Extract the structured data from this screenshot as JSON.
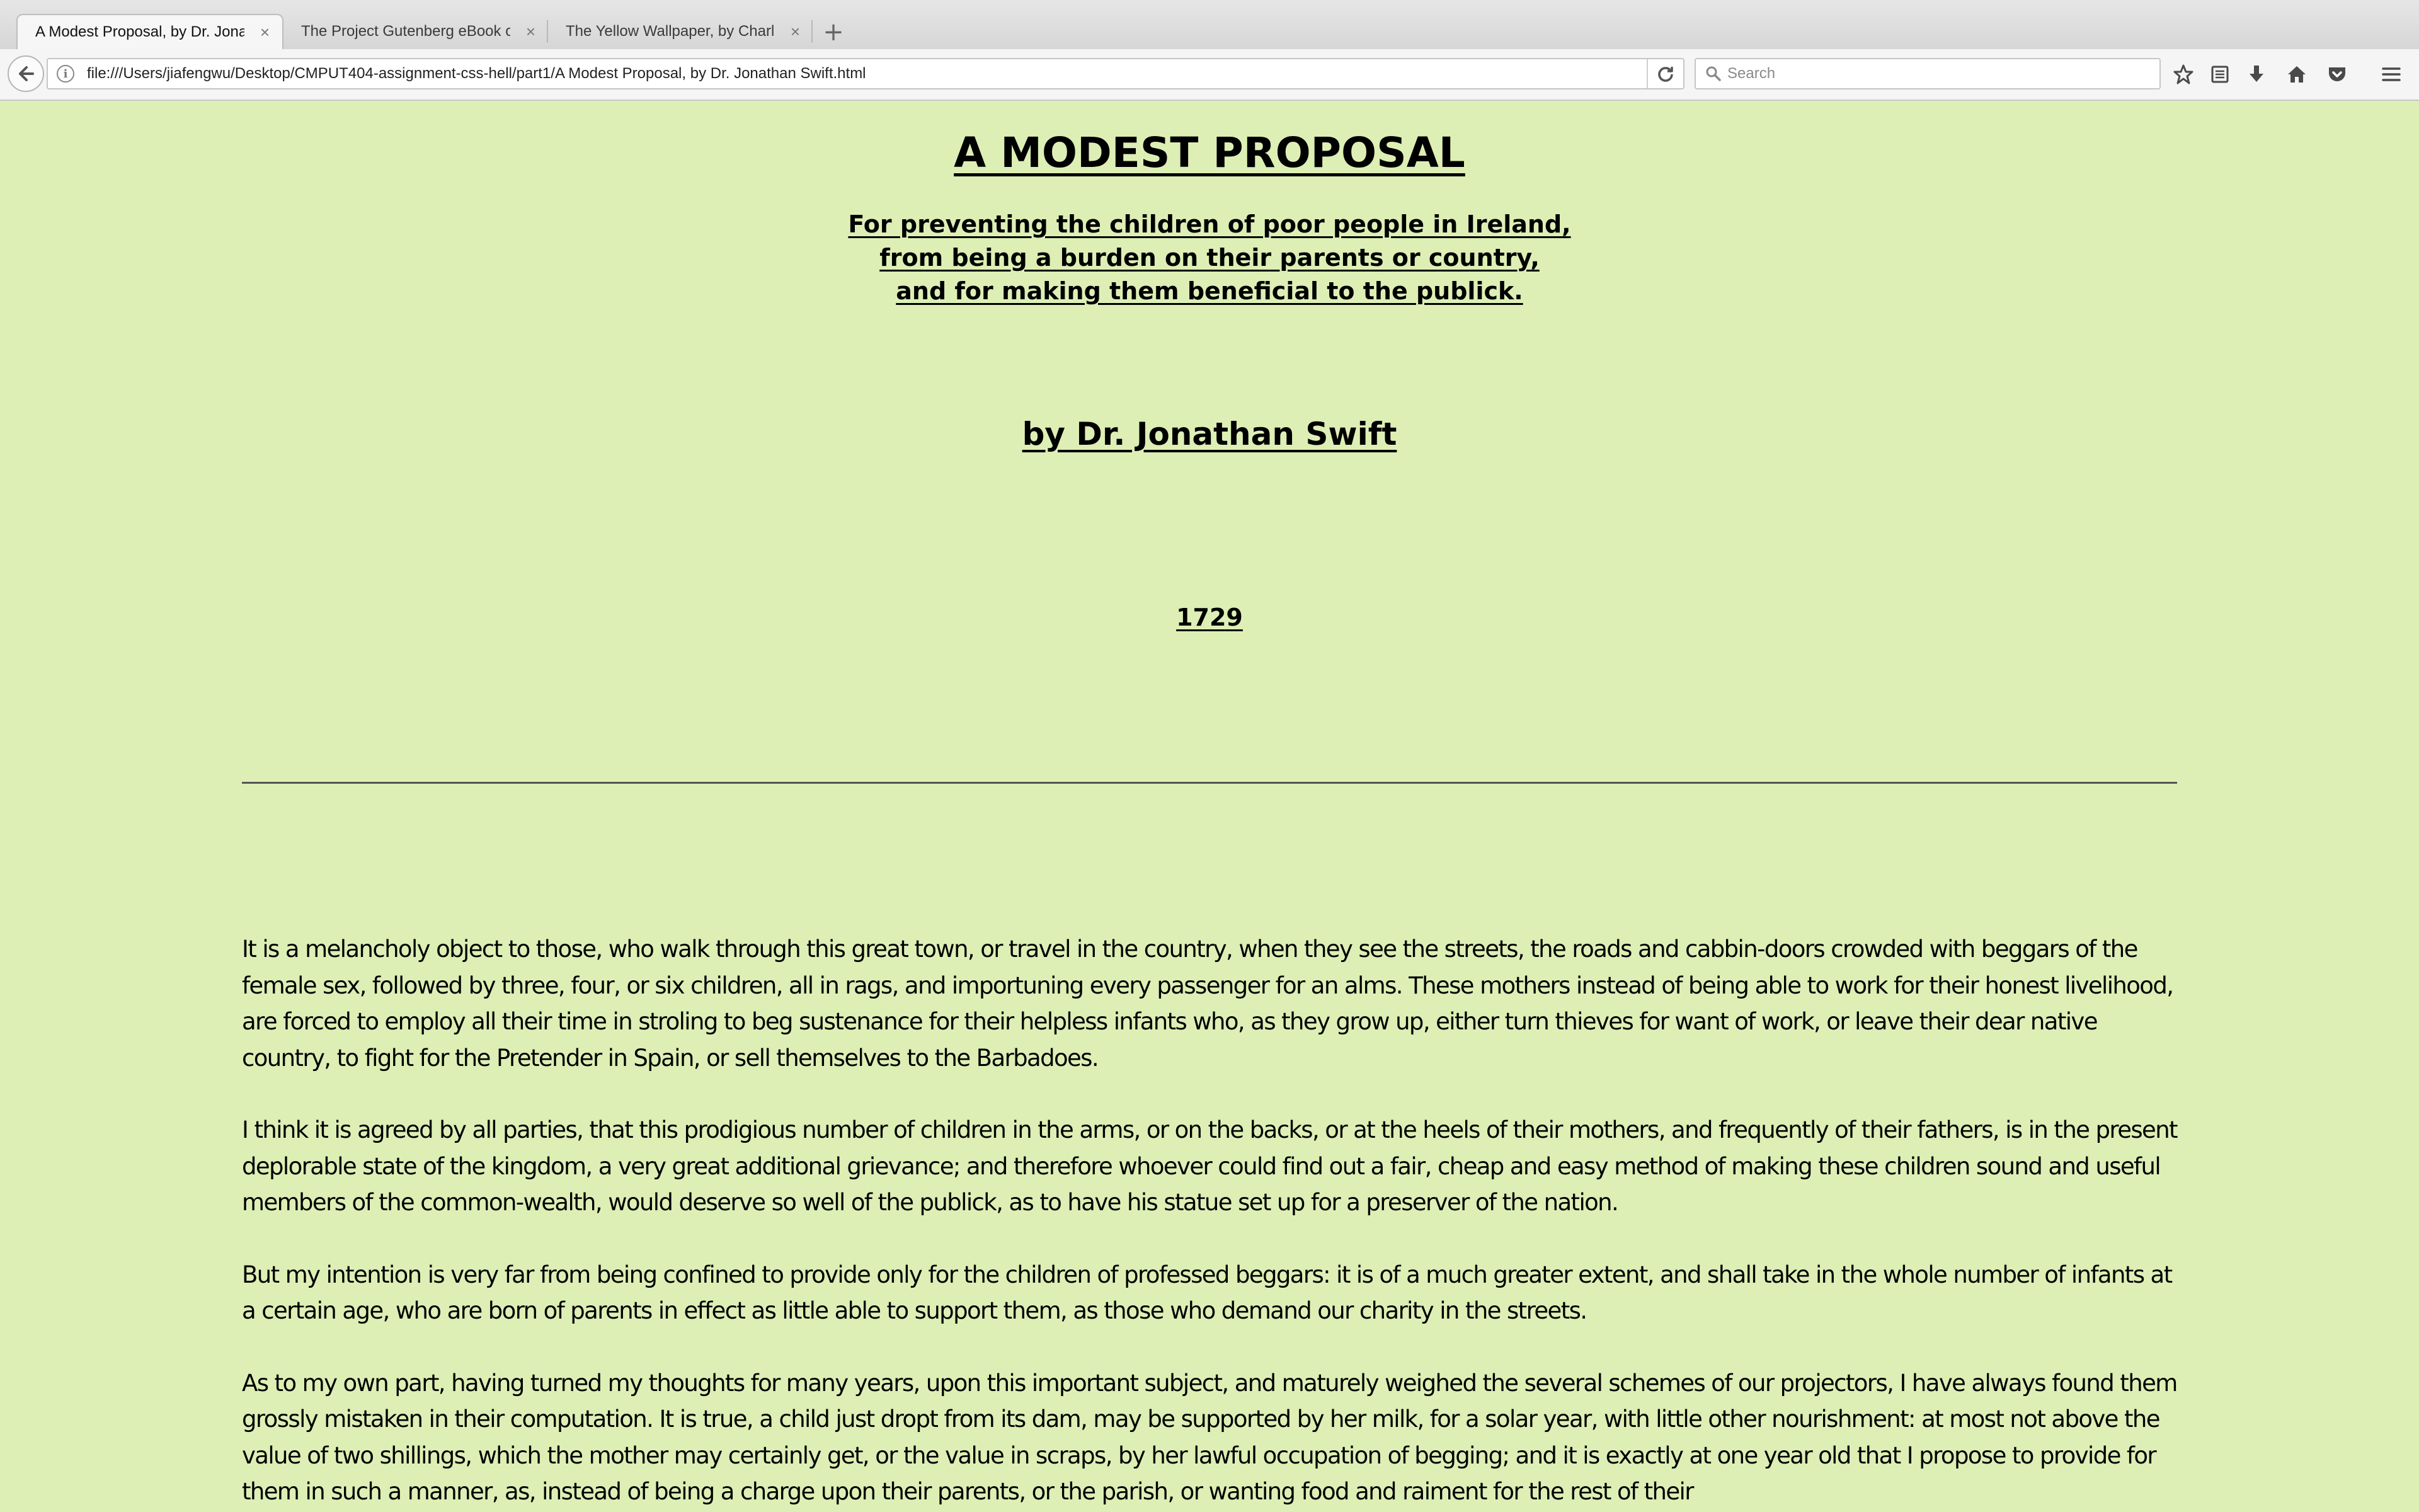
{
  "browser": {
    "tabs": [
      {
        "title": "A Modest Proposal, by Dr. Jona...",
        "active": true
      },
      {
        "title": "The Project Gutenberg eBook o...",
        "active": false
      },
      {
        "title": "The Yellow Wallpaper, by Charl...",
        "active": false
      }
    ],
    "tab_close_glyph": "×",
    "new_tab_glyph": "+",
    "url": "file:///Users/jiafengwu/Desktop/CMPUT404-assignment-css-hell/part1/A Modest Proposal, by Dr. Jonathan Swift.html",
    "search_placeholder": "Search",
    "toolbar_icons": [
      "bookmark-star-icon",
      "reading-list-icon",
      "downloads-icon",
      "home-icon",
      "pocket-icon",
      "menu-icon"
    ]
  },
  "page": {
    "title": "A MODEST PROPOSAL",
    "subtitle_lines": [
      "For preventing the children of poor people in Ireland,",
      "from being a burden on their parents or country,",
      "and for making them beneficial to the publick."
    ],
    "byline": "by Dr. Jonathan Swift",
    "year": "1729",
    "paragraphs": [
      "It is a melancholy object to those, who walk through this great town, or travel in the country, when they see the streets, the roads and cabbin-doors crowded with beggars of the female sex, followed by three, four, or six children, all in rags, and importuning every passenger for an alms. These mothers instead of being able to work for their honest livelihood, are forced to employ all their time in stroling to beg sustenance for their helpless infants who, as they grow up, either turn thieves for want of work, or leave their dear native country, to fight for the Pretender in Spain, or sell themselves to the Barbadoes.",
      "I think it is agreed by all parties, that this prodigious number of children in the arms, or on the backs, or at the heels of their mothers, and frequently of their fathers, is in the present deplorable state of the kingdom, a very great additional grievance; and therefore whoever could find out a fair, cheap and easy method of making these children sound and useful members of the common-wealth, would deserve so well of the publick, as to have his statue set up for a preserver of the nation.",
      "But my intention is very far from being confined to provide only for the children of professed beggars: it is of a much greater extent, and shall take in the whole number of infants at a certain age, who are born of parents in effect as little able to support them, as those who demand our charity in the streets.",
      "As to my own part, having turned my thoughts for many years, upon this important subject, and maturely weighed the several schemes of our projectors, I have always found them grossly mistaken in their computation. It is true, a child just dropt from its dam, may be supported by her milk, for a solar year, with little other nourishment: at most not above the value of two shillings, which the mother may certainly get, or the value in scraps, by her lawful occupation of begging; and it is exactly at one year old that I propose to provide for them in such a manner, as, instead of being a charge upon their parents, or the parish, or wanting food and raiment for the rest of their"
    ]
  },
  "colors": {
    "page_background": "#ddefb5",
    "text": "#000000",
    "rule": "#555555"
  }
}
